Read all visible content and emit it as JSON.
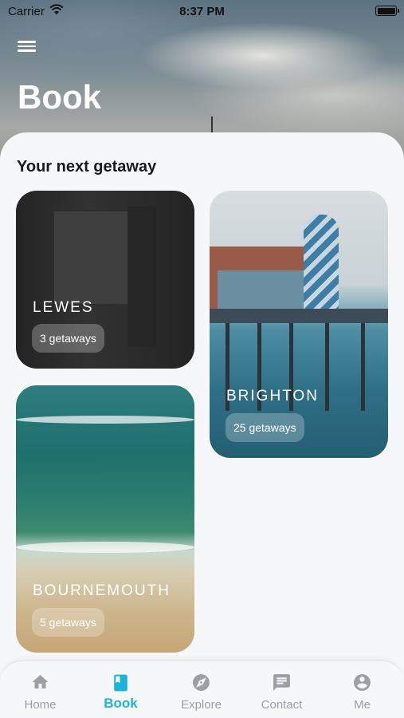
{
  "status_bar": {
    "carrier": "Carrier",
    "time": "8:37 PM"
  },
  "header": {
    "title": "Book"
  },
  "main": {
    "section_title": "Your next getaway",
    "destinations": [
      {
        "name": "LEWES",
        "getaways": "3 getaways"
      },
      {
        "name": "BRIGHTON",
        "getaways": "25 getaways"
      },
      {
        "name": "BOURNEMOUTH",
        "getaways": "5 getaways"
      }
    ]
  },
  "tab_bar": {
    "items": [
      {
        "label": "Home",
        "icon": "home-icon"
      },
      {
        "label": "Book",
        "icon": "book-icon",
        "active": true
      },
      {
        "label": "Explore",
        "icon": "compass-icon"
      },
      {
        "label": "Contact",
        "icon": "chat-icon"
      },
      {
        "label": "Me",
        "icon": "account-icon"
      }
    ]
  },
  "colors": {
    "accent": "#1fb3d9",
    "tab_inactive": "#9aa0a6",
    "sheet": "#f6f7f9"
  }
}
